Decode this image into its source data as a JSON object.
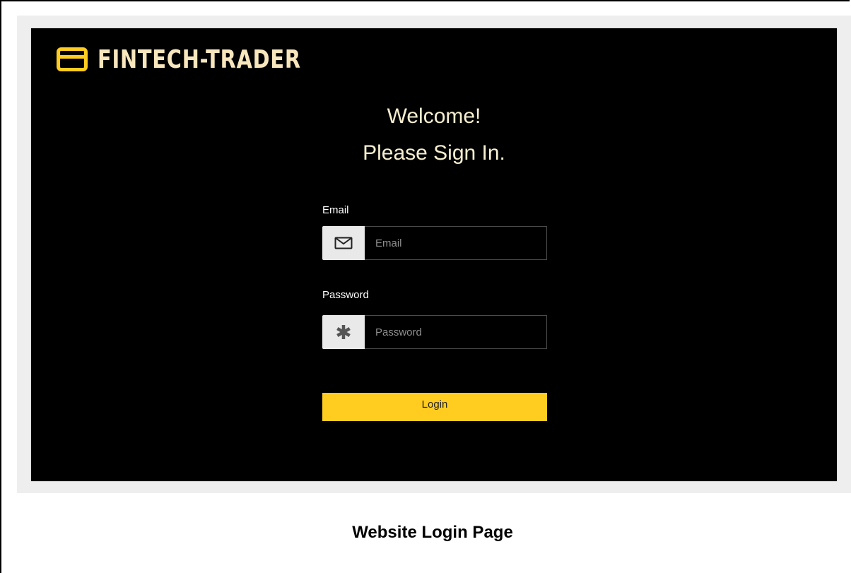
{
  "brand": {
    "name": "FINTECH-TRADER",
    "color": "#ffcc1f",
    "text_color": "#f8e6bd",
    "icon": "credit-card-icon"
  },
  "welcome": {
    "line1": "Welcome!",
    "line2": "Please Sign In."
  },
  "form": {
    "email": {
      "label": "Email",
      "placeholder": "Email",
      "value": "",
      "icon": "envelope-icon"
    },
    "password": {
      "label": "Password",
      "placeholder": "Password",
      "value": "",
      "icon": "asterisk-icon"
    },
    "login_label": "Login",
    "login_color": "#ffcc1f"
  },
  "caption": "Website Login Page"
}
